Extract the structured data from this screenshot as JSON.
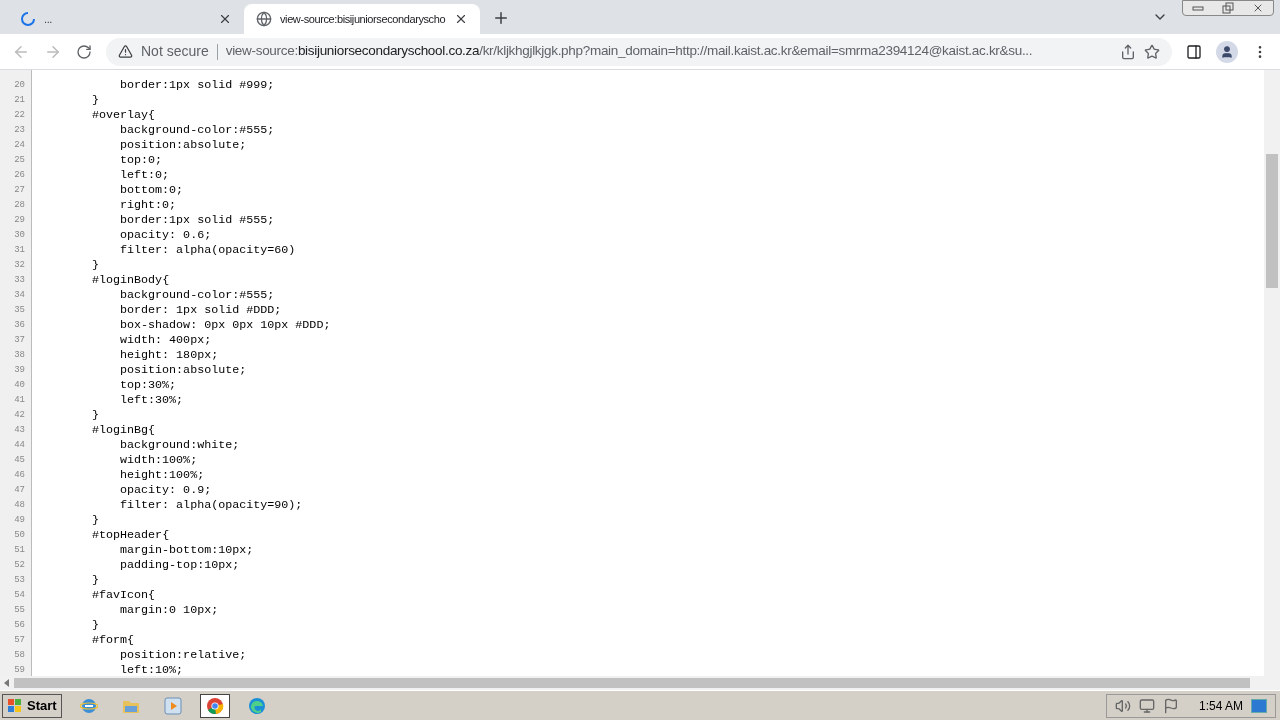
{
  "tabs": [
    {
      "title": "...",
      "loading": true,
      "selected": false
    },
    {
      "title": "view-source:bisijuniorsecondaryscho",
      "loading": false,
      "selected": true
    }
  ],
  "address_bar": {
    "security": "Not secure",
    "scheme": "view-source:",
    "host": "bisijuniorsecondaryschool.co.za",
    "path": "/kr/kljkhgjlkjgk.php?main_domain=http://mail.kaist.ac.kr&email=smrma2394124@kaist.ac.kr&su..."
  },
  "source_lines": [
    {
      "number": "20",
      "kind": "decl",
      "text": "border:1px solid #999;"
    },
    {
      "number": "21",
      "kind": "rule",
      "text": "}"
    },
    {
      "number": "22",
      "kind": "rule",
      "text": "#overlay{"
    },
    {
      "number": "23",
      "kind": "decl",
      "text": "background-color:#555;"
    },
    {
      "number": "24",
      "kind": "decl",
      "text": "position:absolute;"
    },
    {
      "number": "25",
      "kind": "decl",
      "text": "top:0;"
    },
    {
      "number": "26",
      "kind": "decl",
      "text": "left:0;"
    },
    {
      "number": "27",
      "kind": "decl",
      "text": "bottom:0;"
    },
    {
      "number": "28",
      "kind": "decl",
      "text": "right:0;"
    },
    {
      "number": "29",
      "kind": "decl",
      "text": "border:1px solid #555;"
    },
    {
      "number": "30",
      "kind": "decl",
      "text": "opacity: 0.6;"
    },
    {
      "number": "31",
      "kind": "decl",
      "text": "filter: alpha(opacity=60)"
    },
    {
      "number": "32",
      "kind": "rule",
      "text": "}"
    },
    {
      "number": "33",
      "kind": "rule",
      "text": "#loginBody{"
    },
    {
      "number": "34",
      "kind": "decl",
      "text": "background-color:#555;"
    },
    {
      "number": "35",
      "kind": "decl",
      "text": "border: 1px solid #DDD;"
    },
    {
      "number": "36",
      "kind": "decl",
      "text": "box-shadow: 0px 0px 10px #DDD;"
    },
    {
      "number": "37",
      "kind": "decl",
      "text": "width: 400px;"
    },
    {
      "number": "38",
      "kind": "decl",
      "text": "height: 180px;"
    },
    {
      "number": "39",
      "kind": "decl",
      "text": "position:absolute;"
    },
    {
      "number": "40",
      "kind": "decl",
      "text": "top:30%;"
    },
    {
      "number": "41",
      "kind": "decl",
      "text": "left:30%;"
    },
    {
      "number": "42",
      "kind": "rule",
      "text": "}"
    },
    {
      "number": "43",
      "kind": "rule",
      "text": "#loginBg{"
    },
    {
      "number": "44",
      "kind": "decl",
      "text": "background:white;"
    },
    {
      "number": "45",
      "kind": "decl",
      "text": "width:100%;"
    },
    {
      "number": "46",
      "kind": "decl",
      "text": "height:100%;"
    },
    {
      "number": "47",
      "kind": "decl",
      "text": "opacity: 0.9;"
    },
    {
      "number": "48",
      "kind": "decl",
      "text": "filter: alpha(opacity=90);"
    },
    {
      "number": "49",
      "kind": "rule",
      "text": "}"
    },
    {
      "number": "50",
      "kind": "rule",
      "text": "#topHeader{"
    },
    {
      "number": "51",
      "kind": "decl",
      "text": "margin-bottom:10px;"
    },
    {
      "number": "52",
      "kind": "decl",
      "text": "padding-top:10px;"
    },
    {
      "number": "53",
      "kind": "rule",
      "text": "}"
    },
    {
      "number": "54",
      "kind": "rule",
      "text": "#favIcon{"
    },
    {
      "number": "55",
      "kind": "decl",
      "text": "margin:0 10px;"
    },
    {
      "number": "56",
      "kind": "rule",
      "text": "}"
    },
    {
      "number": "57",
      "kind": "rule",
      "text": "#form{"
    },
    {
      "number": "58",
      "kind": "decl",
      "text": "position:relative;"
    },
    {
      "number": "59",
      "kind": "decl",
      "text": "left:10%;"
    }
  ],
  "taskbar": {
    "start": "Start",
    "apps": [
      {
        "kind": "ie",
        "selected": false
      },
      {
        "kind": "folder",
        "selected": false
      },
      {
        "kind": "media",
        "selected": false
      },
      {
        "kind": "chrome",
        "selected": true
      },
      {
        "kind": "edge",
        "selected": false
      }
    ],
    "clock": "1:54 AM"
  }
}
